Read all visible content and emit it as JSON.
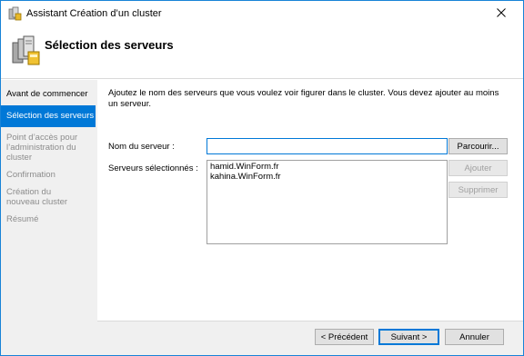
{
  "window": {
    "title": "Assistant Création d’un cluster"
  },
  "header": {
    "title": "Sélection des serveurs"
  },
  "sidebar": {
    "steps": [
      {
        "label": "Avant de commencer",
        "state": "done"
      },
      {
        "label": "Sélection des serveurs",
        "state": "active"
      },
      {
        "label": "Point d’accès pour l’administration du cluster",
        "state": "pending"
      },
      {
        "label": "Confirmation",
        "state": "pending"
      },
      {
        "label": "Création du nouveau cluster",
        "state": "pending"
      },
      {
        "label": "Résumé",
        "state": "pending"
      }
    ]
  },
  "main": {
    "intro": "Ajoutez le nom des serveurs que vous voulez voir figurer dans le cluster. Vous devez ajouter au moins un serveur.",
    "server_name_label": "Nom du serveur :",
    "server_name_value": "",
    "selected_label": "Serveurs sélectionnés :",
    "selected_servers": [
      "hamid.WinForm.fr",
      "kahina.WinForm.fr"
    ],
    "browse_label": "Parcourir...",
    "add_label": "Ajouter",
    "remove_label": "Supprimer"
  },
  "footer": {
    "previous_label": "< Précédent",
    "next_label": "Suivant >",
    "cancel_label": "Annuler"
  },
  "colors": {
    "accent": "#0078d7",
    "sidebar_bg": "#f0f0f0",
    "disabled_text": "#a0a0a0"
  }
}
